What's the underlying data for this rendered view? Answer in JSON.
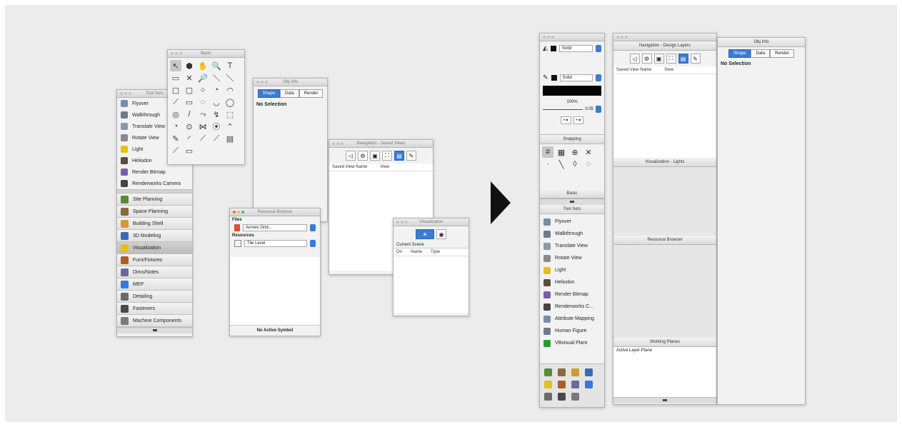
{
  "left": {
    "tools_title": "Tool Sets",
    "basic_title": "Basic",
    "tools": [
      "Flyover",
      "Walkthrough",
      "Translate View",
      "Rotate View",
      "Light",
      "Heliodon",
      "Render Bitmap",
      "Renderworks Camera"
    ],
    "tool_sets": [
      "Site Planning",
      "Space Planning",
      "Building Shell",
      "3D Modeling",
      "Visualization",
      "Furn/Fixtures",
      "Dims/Notes",
      "MEP",
      "Detailing",
      "Fasteners",
      "Machine Components"
    ],
    "selected_set": "Visualization",
    "basic_glyphs": [
      "↖",
      "⬢",
      "✋",
      "🔍",
      "T",
      "▭",
      "✕",
      "🔎",
      "＼",
      "＼",
      "▢",
      "▢",
      "○",
      "◔",
      "◠",
      "⟋",
      "▭",
      "◌",
      "◡",
      "◯",
      "◎",
      "/",
      "⤳",
      "↯",
      "⬚",
      "◔",
      "⊙",
      "⋈",
      "⦿",
      "⌃",
      "✎",
      "◜",
      "⟋",
      "⟋",
      "▤",
      "⟋",
      "▭"
    ],
    "obj_info": {
      "title": "Obj Info",
      "tabs": [
        "Shape",
        "Data",
        "Render"
      ],
      "status": "No Selection"
    },
    "navigation": {
      "title": "Navigation - Saved Views",
      "col1": "Saved View Name",
      "col2": "View"
    },
    "resource": {
      "title": "Resource Browser",
      "files": "Files",
      "resources": "Resources",
      "file_value": "Arrows Grid...",
      "res_value": "Tile Level",
      "status": "No Active Symbol"
    },
    "visualization": {
      "title": "Visualization",
      "scene": "Current Scene",
      "cols": [
        "On",
        "Name",
        "Type"
      ]
    }
  },
  "right": {
    "attributes": {
      "fill_label": "Solid",
      "pen_label": "Solid",
      "opacity": "100%",
      "thickness": "0.05"
    },
    "snapping_title": "Snapping",
    "basic_title": "Basic",
    "tool_sets_title": "Tool Sets",
    "tools": [
      "Flyover",
      "Walkthrough",
      "Translate View",
      "Rotate View",
      "Light",
      "Heliodon",
      "Render Bitmap",
      "Renderworks C...",
      "Attribute Mapping",
      "Human Figure",
      "VBvisual Plant"
    ],
    "navigation": {
      "title": "Navigation - Design Layers",
      "col1": "Saved View Name",
      "col2": "View"
    },
    "visualization_title": "Visualization - Lights",
    "resource_title": "Resource Browser",
    "working_planes": {
      "title": "Working Planes",
      "item": "Active Layer Plane"
    },
    "obj_info": {
      "title": "Obj Info",
      "tabs": [
        "Shape",
        "Data",
        "Render"
      ],
      "status": "No Selection"
    }
  },
  "colors": {
    "accent": "#3a7bd5",
    "bg": "#ececec",
    "arrow": "#111111"
  }
}
